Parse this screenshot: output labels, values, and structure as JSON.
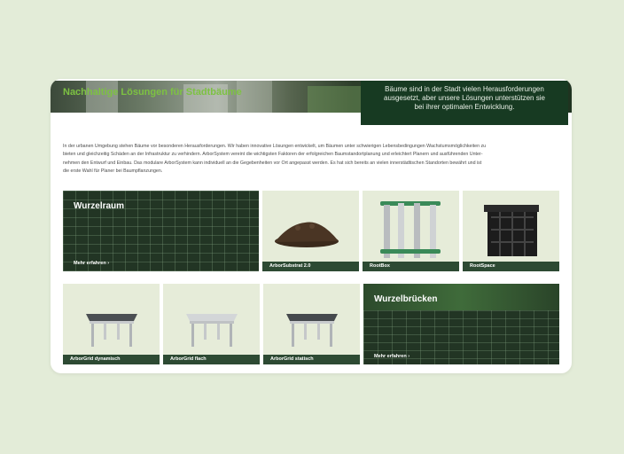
{
  "hero": {
    "title": "Nachhaltige Lösungen für Stadtbäume",
    "box_lines": [
      "Bäume sind in der Stadt vielen Herausforderungen",
      "ausgesetzt, aber unsere Lösungen unterstützen sie",
      "bei ihrer optimalen Entwicklung."
    ]
  },
  "intro": {
    "lines": [
      "In der urbanen Umgebung stehen Bäume vor besonderen Herausforderungen. Wir haben innovative Lösungen entwickelt, um Bäumen unter schwierigen Lebensbedingungen Wachstumsmöglichkeiten zu",
      "bieten und gleichzeitig Schäden an der Infrastruktur zu verhindern. ArborSystem vereint die wichtigsten Faktoren der erfolgreichen Baumstandortplanung und erleichtert Planern und ausführenden Unter-",
      "nehmen den Entwurf und Einbau. Das modulare ArborSystem kann individuell an die Gegebenheiten vor Ort angepasst werden. Es hat sich bereits an vielen innerstädtischen Standorten bewährt und ist",
      "die erste Wahl für Planer bei Baumpflanzungen."
    ]
  },
  "tiles": {
    "wurzelraum": {
      "title": "Wurzelraum",
      "more": "Mehr erfahren"
    },
    "arborsubstrat": {
      "label": "ArborSubstrat 2.0"
    },
    "rootbox": {
      "label": "RootBox"
    },
    "rootspace": {
      "label": "RootSpace"
    },
    "arborgrid_dynamisch": {
      "label": "ArborGrid dynamisch"
    },
    "arborgrid_flach": {
      "label": "ArborGrid flach"
    },
    "arborgrid_statisch": {
      "label": "ArborGrid statisch"
    },
    "wurzelbruecken": {
      "title": "Wurzelbrücken",
      "more": "Mehr erfahren"
    }
  },
  "icons": {
    "more_arrow": "chevron-right-icon"
  },
  "colors": {
    "background": "#e3ecd8",
    "accent_green": "#7dc242",
    "dark_green": "#173a22",
    "label_bar": "#2d4a33",
    "tile_bg": "#e6ecd9"
  }
}
